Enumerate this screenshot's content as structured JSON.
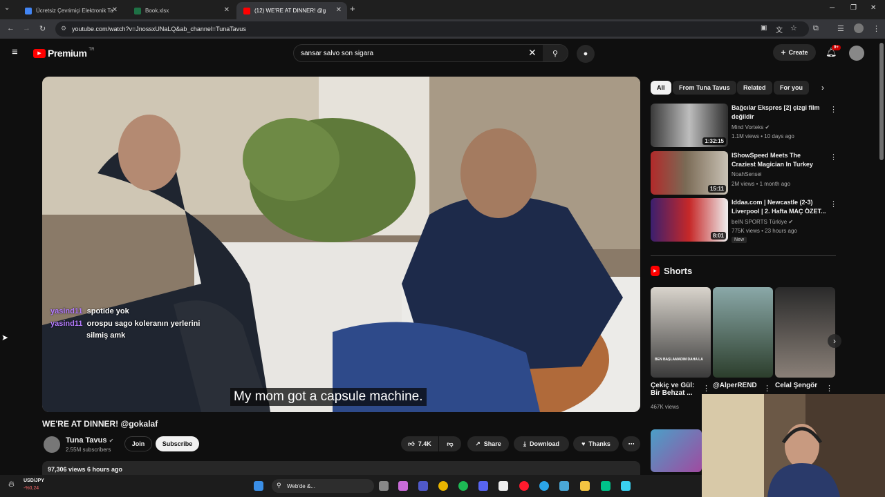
{
  "browser": {
    "tabs": [
      {
        "label": "Ücretsiz Çevrimiçi Elektronik Ta",
        "color": "#4285f4"
      },
      {
        "label": "Book.xlsx",
        "color": "#1e7145"
      },
      {
        "label": "(12) WE'RE AT DINNER! @g",
        "color": "#ff0000"
      }
    ],
    "url": "youtube.com/watch?v=JnossxUNaLQ&ab_channel=TunaTavus"
  },
  "header": {
    "logo": "Premium",
    "logo_region": "TR",
    "search_value": "sansar salvo son sigara",
    "create_label": "Create",
    "notif_badge": "9+"
  },
  "video": {
    "caption": "My mom got a capsule machine.",
    "chat": [
      {
        "user": "yasind11",
        "text": "spotide yok"
      },
      {
        "user": "yasind11",
        "text": "orospu sago koleranın yerlerini"
      },
      {
        "user": "",
        "text": "silmiş amk"
      }
    ],
    "title": "WE'RE AT DINNER! @gokalaf"
  },
  "channel": {
    "name": "Tuna Tavus",
    "subs": "2.55M subscribers",
    "join": "Join",
    "subscribe": "Subscribe"
  },
  "actions": {
    "likes": "7.4K",
    "share": "Share",
    "download": "Download",
    "thanks": "Thanks"
  },
  "description": {
    "meta": "97,306 views  6 hours ago"
  },
  "chips": [
    "All",
    "From Tuna Tavus",
    "Related",
    "For you"
  ],
  "related": [
    {
      "title_a": "Bağcılar Ekspres [2] çizgi film",
      "title_b": "değildir",
      "channel": "Mind Vorteks",
      "meta": "1.1M views • 10 days ago",
      "duration": "1:32:15"
    },
    {
      "title_a": "IShowSpeed Meets The",
      "title_b": "Craziest Magician In Turkey",
      "channel": "NoahSensei",
      "meta": "2M views • 1 month ago",
      "duration": "15:11"
    },
    {
      "title_a": "Iddaa.com | Newcastle (2-3)",
      "title_b": "Liverpool | 2. Hafta MAÇ ÖZET...",
      "channel": "beIN SPORTS Türkiye",
      "meta": "775K views • 23 hours ago",
      "duration": "8:01",
      "badge": "New"
    }
  ],
  "shorts": {
    "heading": "Shorts",
    "items": [
      {
        "title_a": "Çekiç ve Gül:",
        "title_b": "Bir Behzat ...",
        "views": "467K views",
        "thumb_text": "BEN BAŞLAMADIM DAHA LA"
      },
      {
        "title_a": "@AlperREND",
        "title_b": "",
        "views": ""
      },
      {
        "title_a": "Celal Şengör",
        "title_b": "",
        "views": ""
      }
    ]
  },
  "taskbar": {
    "ticker": "USD/JPY",
    "ticker_change": "-%0,24",
    "search": "Web'de &..."
  }
}
